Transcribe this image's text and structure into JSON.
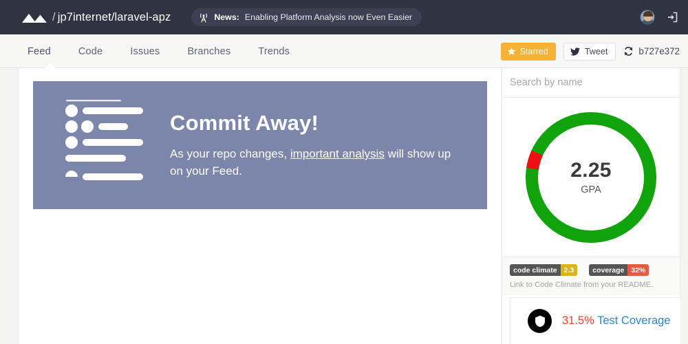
{
  "topbar": {
    "logo_icon": "mountains-logo-icon",
    "repo_slash": "/",
    "repo_path": "jp7internet/laravel-apz",
    "news": {
      "icon": "broadcast-tower-icon",
      "label": "News:",
      "text": "Enabling Platform Analysis now Even Easier"
    },
    "avatar_name": "user-avatar",
    "signin_icon": "sign-in-icon",
    "bg_color": "#2f3342"
  },
  "nav": {
    "tabs": [
      {
        "label": "Feed",
        "active": true
      },
      {
        "label": "Code",
        "active": false
      },
      {
        "label": "Issues",
        "active": false
      },
      {
        "label": "Branches",
        "active": false
      },
      {
        "label": "Trends",
        "active": false
      }
    ],
    "starred_button": {
      "label": "Starred",
      "icon": "star-icon",
      "bg_color": "#f5b234"
    },
    "tweet_button": {
      "label": "Tweet",
      "icon": "twitter-bird-icon"
    },
    "commit_ref": {
      "label": "b727e372",
      "icon": "refresh-sync-icon"
    }
  },
  "promo": {
    "title": "Commit Away!",
    "body_before": "As your repo changes, ",
    "body_link": "important analysis",
    "body_after": " will show up on your Feed.",
    "bg_color": "#7c86ab",
    "illustration": "commit-list-illustration"
  },
  "sidebar": {
    "search": {
      "placeholder": "Search by name",
      "value": ""
    },
    "gpa": {
      "value": "2.25",
      "label": "GPA",
      "green_color": "#11a30c",
      "red_color": "#ee1111",
      "red_fraction_percent": 4.5
    },
    "badges": [
      {
        "key": "code climate",
        "value": "2.3",
        "key_color": "#555555",
        "value_color": "#dfb317"
      },
      {
        "key": "coverage",
        "value": "32%",
        "key_color": "#555555",
        "value_color": "#e05d44"
      }
    ],
    "badge_note": "Link to Code Climate from your README.",
    "coverage_card": {
      "icon": "shield-icon",
      "percent": "31.5%",
      "label": " Test Coverage",
      "percent_color": "#e8452c",
      "label_color": "#2b87d4"
    }
  }
}
